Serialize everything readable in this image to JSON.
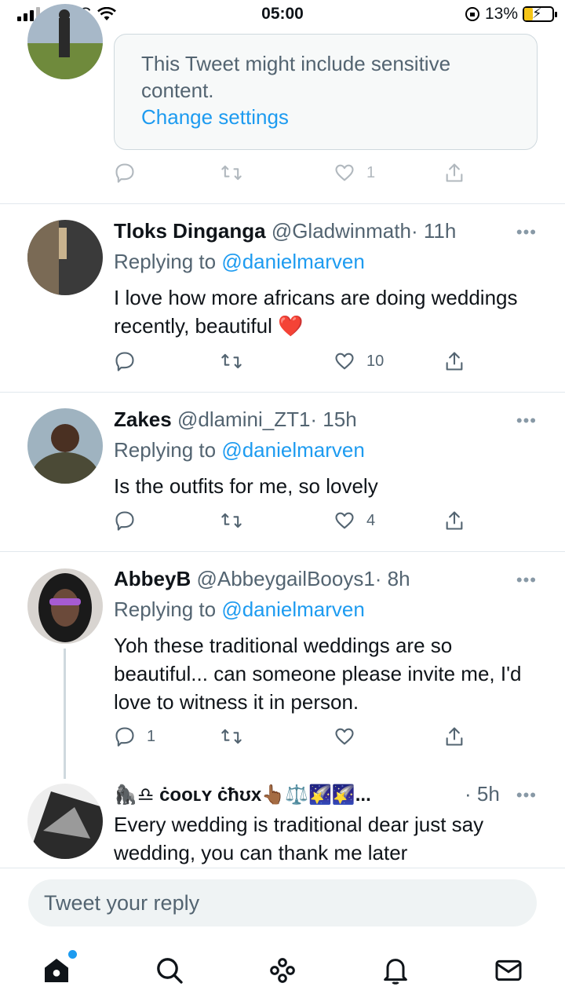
{
  "status_bar": {
    "carrier": "Cell C",
    "time": "05:00",
    "battery": "13%"
  },
  "tweet0": {
    "sensitive_text": "This Tweet might include sensitive content.",
    "change_settings": "Change settings",
    "likes": "1"
  },
  "tweets": [
    {
      "name": "Tloks Dinganga",
      "handle": "@Gladwinmath",
      "time": "· 11h",
      "replying_prefix": "Replying to",
      "replying_to": "@danielmarven",
      "text": "I love how more africans are doing weddings recently, beautiful ❤️",
      "replies": "",
      "likes": "10"
    },
    {
      "name": "Zakes",
      "handle": "@dlamini_ZT1",
      "time": "· 15h",
      "replying_prefix": "Replying to",
      "replying_to": "@danielmarven",
      "text": "Is the outfits for me, so lovely",
      "replies": "",
      "likes": "4"
    },
    {
      "name": "AbbeyB",
      "handle": "@AbbeygailBooys1",
      "time": "· 8h",
      "replying_prefix": "Replying to",
      "replying_to": "@danielmarven",
      "text": "Yoh these traditional weddings are so beautiful... can someone please invite me, I'd love to witness it in person.",
      "replies": "1",
      "likes": ""
    },
    {
      "name": "🦍♎ ċᴏᴏʟʏ ċħʊx👆🏾⚖️🌠🌠...",
      "handle": "",
      "time": "· 5h",
      "text": "Every wedding is traditional dear just say wedding, you can thank me later"
    }
  ],
  "more_label": "•••",
  "reply_placeholder": "Tweet your reply",
  "tabbar": [
    "home-icon",
    "search-icon",
    "spaces-icon",
    "notifications-icon",
    "messages-icon"
  ],
  "colors": {
    "accent": "#1d9bf0",
    "text": "#0f1419",
    "muted": "#536471"
  }
}
